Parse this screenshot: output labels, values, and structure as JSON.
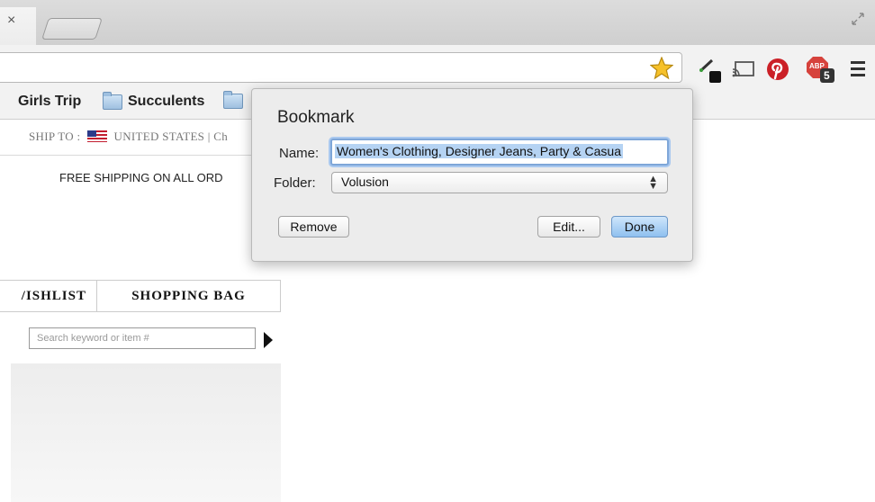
{
  "browser": {
    "tab_close": "×",
    "icons": [
      "fullscreen-icon",
      "star-icon",
      "eyedropper-icon",
      "cast-icon",
      "pinterest-icon",
      "adblock-plus-icon",
      "menu-icon"
    ],
    "abp_badge": "ABP",
    "abp_count": "5",
    "bookmarks_bar": [
      {
        "label": "Girls Trip",
        "folder": false
      },
      {
        "label": "Succulents",
        "folder": true
      },
      {
        "label": "",
        "folder": true
      }
    ]
  },
  "page": {
    "ship_to_label": "SHIP TO :",
    "ship_to_country": "UNITED STATES",
    "ship_to_sep": "| Ch",
    "free_shipping": "FREE SHIPPING ON ALL ORD",
    "tabs": [
      "/ISHLIST",
      "SHOPPING BAG"
    ],
    "search_placeholder": "Search keyword or item #"
  },
  "bookmark_popup": {
    "title": "Bookmark",
    "name_label": "Name:",
    "name_value": "Women's Clothing, Designer Jeans, Party & Casua",
    "folder_label": "Folder:",
    "folder_value": "Volusion",
    "select_arrows": "⌃⌄",
    "remove": "Remove",
    "edit": "Edit...",
    "done": "Done"
  },
  "colors": {
    "star": "#f6c12a",
    "pinterest": "#cb2027",
    "abp": "#d6423c",
    "done_button": "#8fc0ef"
  }
}
